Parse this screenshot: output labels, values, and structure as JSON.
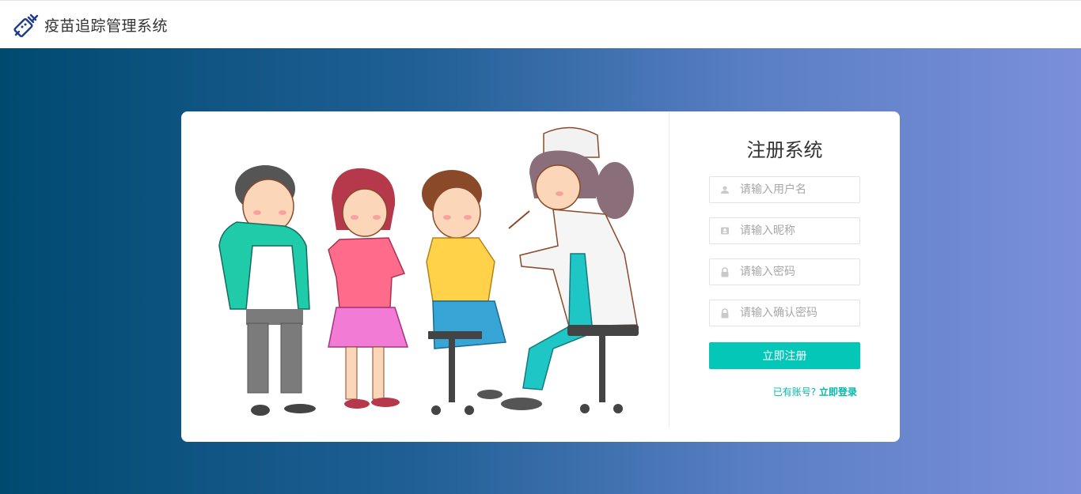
{
  "header": {
    "app_title": "疫苗追踪管理系统",
    "logo_icon": "syringe-icon",
    "logo_color": "#1e3a8a"
  },
  "colors": {
    "accent": "#05c7b8",
    "gradient_start": "#004a70",
    "gradient_end": "#7b8fda"
  },
  "illustration": {
    "description_icon": "children-vaccination-illustration"
  },
  "form": {
    "title": "注册系统",
    "username_placeholder": "请输入用户名",
    "username_icon": "user-icon",
    "nickname_placeholder": "请输入昵称",
    "nickname_icon": "id-card-icon",
    "password_placeholder": "请输入密码",
    "password_icon": "lock-icon",
    "confirm_placeholder": "请输入确认密码",
    "confirm_icon": "lock-icon",
    "submit_label": "立即注册",
    "login_prompt": "已有账号?",
    "login_link": "立即登录"
  }
}
